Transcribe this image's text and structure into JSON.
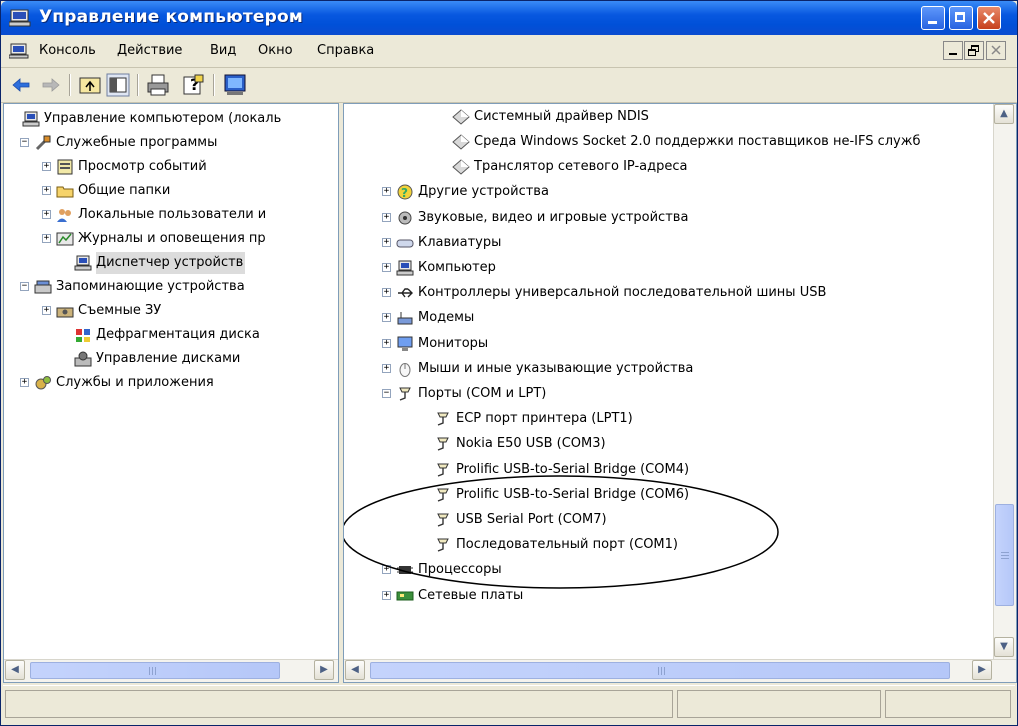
{
  "window": {
    "title": "Управление компьютером"
  },
  "menubar": {
    "items": [
      "Консоль",
      "Действие",
      "Вид",
      "Окно",
      "Справка"
    ]
  },
  "toolbar": {
    "buttons": [
      "back-icon",
      "forward-icon",
      "up-folder-icon",
      "show-hide-tree-icon",
      "print-icon",
      "help-icon",
      "console-icon"
    ]
  },
  "left_tree": {
    "items": [
      {
        "label": "Управление компьютером (локаль",
        "icon": "computer-management-icon",
        "expander": ""
      },
      {
        "label": "Служебные программы",
        "icon": "tools-icon",
        "expander": "−"
      },
      {
        "label": "Просмотр событий",
        "icon": "event-viewer-icon",
        "expander": "+"
      },
      {
        "label": "Общие папки",
        "icon": "shared-folder-icon",
        "expander": "+"
      },
      {
        "label": "Локальные пользователи и",
        "icon": "users-icon",
        "expander": "+"
      },
      {
        "label": "Журналы и оповещения пр",
        "icon": "performance-logs-icon",
        "expander": "+"
      },
      {
        "label": "Диспетчер устройств",
        "icon": "device-manager-icon",
        "expander": ""
      },
      {
        "label": "Запоминающие устройства",
        "icon": "storage-icon",
        "expander": "−"
      },
      {
        "label": "Съемные ЗУ",
        "icon": "removable-storage-icon",
        "expander": "+"
      },
      {
        "label": "Дефрагментация диска",
        "icon": "defrag-icon",
        "expander": ""
      },
      {
        "label": "Управление дисками",
        "icon": "disk-management-icon",
        "expander": ""
      },
      {
        "label": "Службы и приложения",
        "icon": "services-icon",
        "expander": "+"
      }
    ]
  },
  "right_tree": {
    "items": [
      {
        "label": "Системный драйвер NDIS",
        "icon": "diamond-icon",
        "expander": ""
      },
      {
        "label": "Среда Windows Socket 2.0 поддержки поставщиков не-IFS служб",
        "icon": "diamond-icon",
        "expander": ""
      },
      {
        "label": "Транслятор сетевого IP-адреса",
        "icon": "diamond-icon",
        "expander": ""
      },
      {
        "label": "Другие устройства",
        "icon": "unknown-device-icon",
        "expander": "+"
      },
      {
        "label": "Звуковые, видео и игровые устройства",
        "icon": "sound-icon",
        "expander": "+"
      },
      {
        "label": "Клавиатуры",
        "icon": "keyboard-icon",
        "expander": "+"
      },
      {
        "label": "Компьютер",
        "icon": "computer-icon",
        "expander": "+"
      },
      {
        "label": "Контроллеры универсальной последовательной шины USB",
        "icon": "usb-icon",
        "expander": "+"
      },
      {
        "label": "Модемы",
        "icon": "modem-icon",
        "expander": "+"
      },
      {
        "label": "Мониторы",
        "icon": "monitor-icon",
        "expander": "+"
      },
      {
        "label": "Мыши и иные указывающие устройства",
        "icon": "mouse-icon",
        "expander": "+"
      },
      {
        "label": "Порты (COM и LPT)",
        "icon": "port-icon",
        "expander": "−"
      },
      {
        "label": "ECP порт принтера (LPT1)",
        "icon": "port-icon",
        "expander": ""
      },
      {
        "label": "Nokia E50 USB (COM3)",
        "icon": "port-icon",
        "expander": ""
      },
      {
        "label": "Prolific USB-to-Serial Bridge (COM4)",
        "icon": "port-icon",
        "expander": ""
      },
      {
        "label": "Prolific USB-to-Serial Bridge (COM6)",
        "icon": "port-icon",
        "expander": ""
      },
      {
        "label": "USB Serial Port (COM7)",
        "icon": "port-icon",
        "expander": ""
      },
      {
        "label": "Последовательный порт (COM1)",
        "icon": "port-icon",
        "expander": ""
      },
      {
        "label": "Процессоры",
        "icon": "processor-icon",
        "expander": "+"
      },
      {
        "label": "Сетевые платы",
        "icon": "network-card-icon",
        "expander": "+"
      }
    ]
  },
  "colors": {
    "title_blue": "#0054e3",
    "xp_face": "#ece9d8",
    "close_red": "#d4502a"
  }
}
